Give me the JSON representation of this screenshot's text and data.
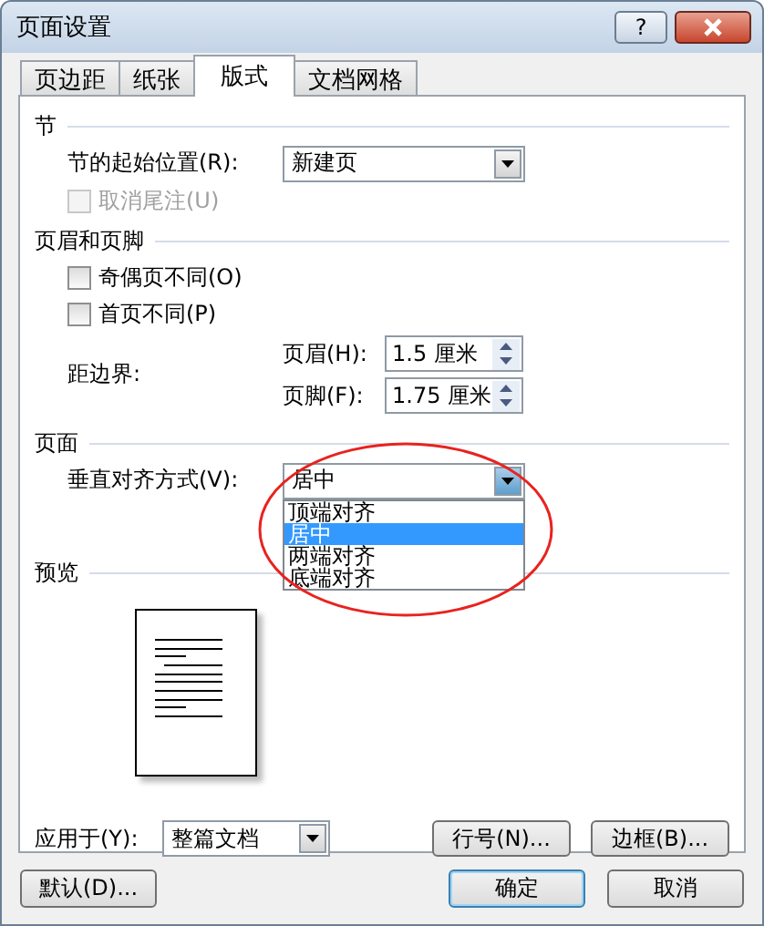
{
  "window": {
    "title": "页面设置",
    "help": "?"
  },
  "tabs": [
    {
      "label": "页边距",
      "selected": false
    },
    {
      "label": "纸张",
      "selected": false
    },
    {
      "label": "版式",
      "selected": true
    },
    {
      "label": "文档网格",
      "selected": false
    }
  ],
  "section": {
    "title": "节",
    "start_label": "节的起始位置(R):",
    "start_value": "新建页",
    "suppress_endnotes": {
      "label": "取消尾注(U)",
      "checked": false,
      "disabled": true
    }
  },
  "headers_footers": {
    "title": "页眉和页脚",
    "checkboxes": [
      {
        "label": "奇偶页不同(O)",
        "checked": false,
        "disabled": false
      },
      {
        "label": "首页不同(P)",
        "checked": false,
        "disabled": false
      }
    ],
    "distance_label": "距边界:",
    "spinners": [
      {
        "label": "页眉(H):",
        "value": "1.5 厘米"
      },
      {
        "label": "页脚(F):",
        "value": "1.75 厘米"
      }
    ]
  },
  "page": {
    "title": "页面",
    "valign_label": "垂直对齐方式(V):",
    "valign_value": "居中",
    "open": true,
    "options": [
      {
        "label": "顶端对齐",
        "selected": false
      },
      {
        "label": "居中",
        "selected": true
      },
      {
        "label": "两端对齐",
        "selected": false
      },
      {
        "label": "底端对齐",
        "selected": false
      }
    ]
  },
  "preview": {
    "title": "预览"
  },
  "apply": {
    "label": "应用于(Y):",
    "value": "整篇文档",
    "buttons": [
      "行号(N)...",
      "边框(B)..."
    ]
  },
  "footer_buttons": [
    {
      "label": "默认(D)...",
      "default": false
    },
    {
      "label": "确定",
      "default": true
    },
    {
      "label": "取消",
      "default": false
    }
  ],
  "annotations": [
    {
      "kind": "ellipse"
    }
  ]
}
